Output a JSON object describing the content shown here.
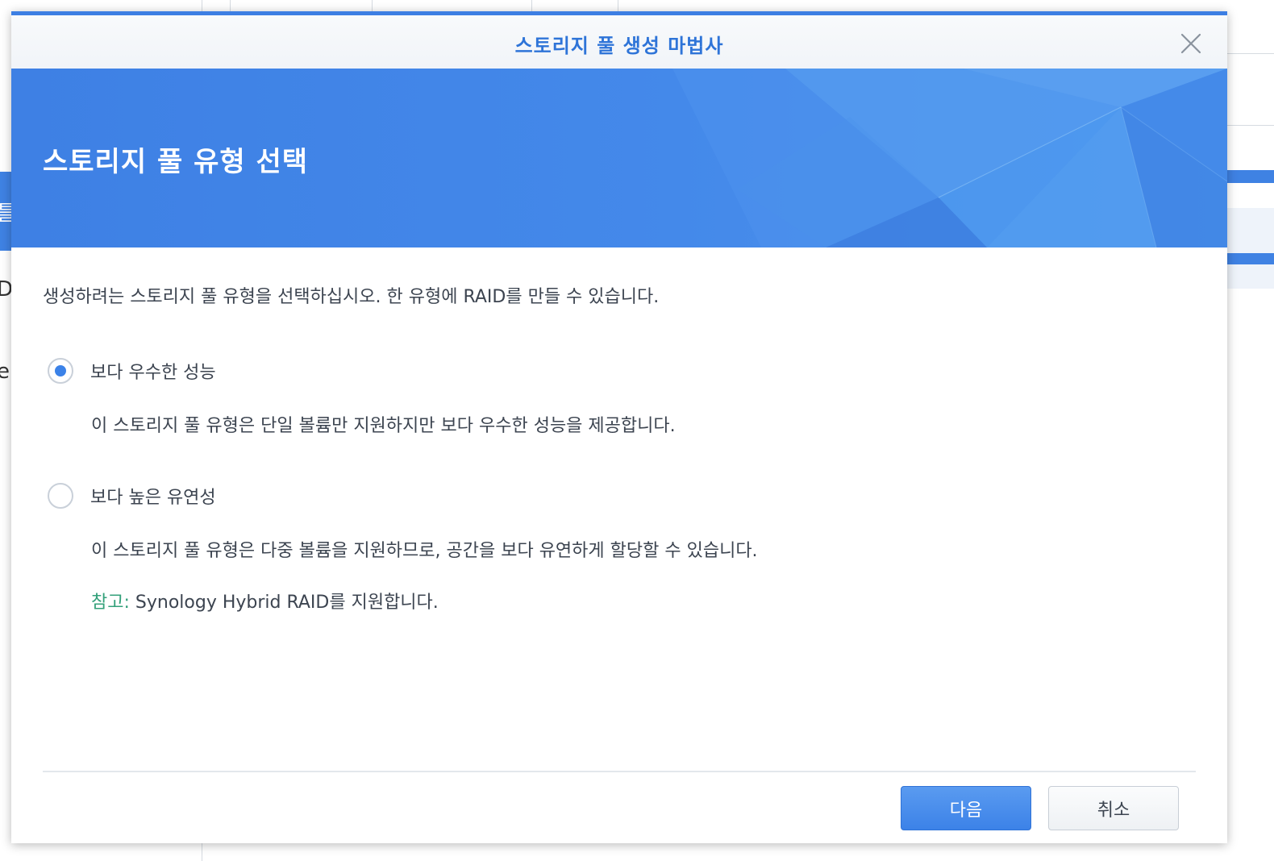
{
  "background": {
    "left_glyphs": [
      "틀",
      "D",
      "e"
    ]
  },
  "dialog": {
    "title": "스토리지 풀 생성 마법사",
    "banner_title": "스토리지 풀 유형 선택",
    "intro": "생성하려는 스토리지 풀 유형을 선택하십시오. 한 유형에 RAID를 만들 수 있습니다.",
    "options": [
      {
        "label": "보다 우수한 성능",
        "description": "이 스토리지 풀 유형은 단일 볼륨만 지원하지만 보다 우수한 성능을 제공합니다.",
        "selected": true
      },
      {
        "label": "보다 높은 유연성",
        "description": "이 스토리지 풀 유형은 다중 볼륨을 지원하므로, 공간을 보다 유연하게 할당할 수 있습니다.",
        "note_prefix": "참고:",
        "note_text": " Synology Hybrid RAID를 지원합니다.",
        "selected": false
      }
    ],
    "buttons": {
      "next": "다음",
      "cancel": "취소"
    },
    "icons": {
      "close": "close-icon"
    },
    "colors": {
      "accent": "#3d7fe3",
      "title": "#2e74d8",
      "note": "#33a07a"
    }
  }
}
